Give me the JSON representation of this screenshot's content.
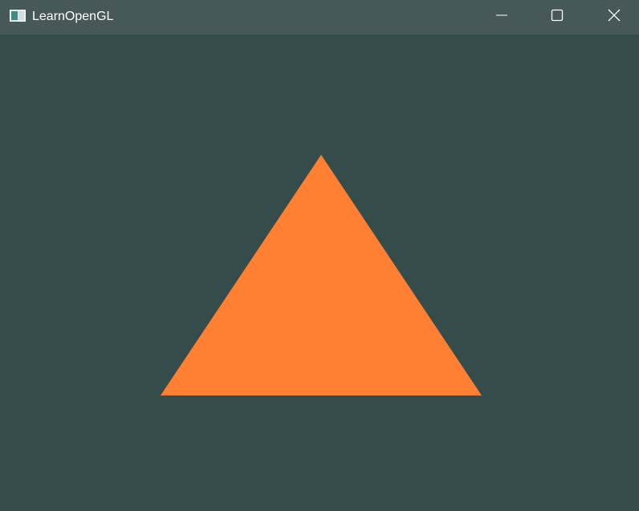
{
  "window": {
    "title": "LearnOpenGL",
    "app_icon": "window-app-icon",
    "controls": [
      "minimize-icon",
      "maximize-icon",
      "close-icon"
    ]
  },
  "colors": {
    "titlebar": "#465857",
    "clear_color": "#344c4c",
    "triangle_fill": "#ff8032",
    "title_text": "#ffffff"
  }
}
